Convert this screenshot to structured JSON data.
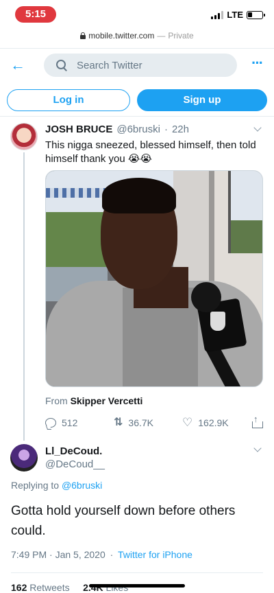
{
  "status_bar": {
    "time": "5:15",
    "network": "LTE"
  },
  "browser": {
    "domain": "mobile.twitter.com",
    "separator": "—",
    "private_label": "Private"
  },
  "header": {
    "search_placeholder": "Search Twitter"
  },
  "auth": {
    "login_label": "Log in",
    "signup_label": "Sign up"
  },
  "parent_tweet": {
    "name": "JOSH BRUCE",
    "handle": "@6bruski",
    "time_ago": "22h",
    "text": "This nigga sneezed, blessed himself, then told himself thank you 😭😭",
    "from_prefix": "From",
    "from_name": "Skipper Vercetti",
    "replies": "512",
    "retweets": "36.7K",
    "likes": "162.9K"
  },
  "reply_tweet": {
    "name": "Ll_DeCoud.",
    "handle": "@DeCoud__",
    "replying_prefix": "Replying to",
    "replying_to": "@6bruski",
    "text": "Gotta hold yourself down before others could.",
    "timestamp": "7:49 PM · Jan 5, 2020",
    "dot": "·",
    "source": "Twitter for iPhone",
    "retweets_count": "162",
    "retweets_label": "Retweets",
    "likes_count": "2.4K",
    "likes_label": "Likes"
  },
  "colors": {
    "accent": "#1da1f2",
    "time_pill": "#e0383e"
  }
}
